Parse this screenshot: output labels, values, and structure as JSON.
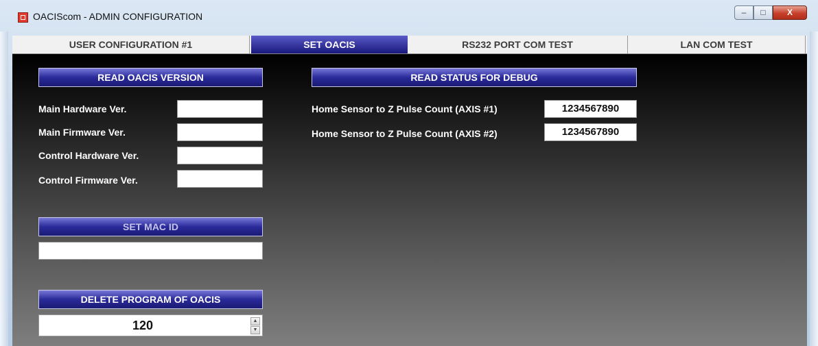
{
  "window": {
    "title": "OACIScom - ADMIN CONFIGURATION",
    "controls": {
      "minimize": "–",
      "maximize": "□",
      "close": "X"
    }
  },
  "tabs": [
    {
      "label": "USER CONFIGURATION #1"
    },
    {
      "label": "SET OACIS",
      "active": true
    },
    {
      "label": "RS232 PORT COM TEST"
    },
    {
      "label": "LAN COM TEST"
    }
  ],
  "version": {
    "button": "READ OACIS VERSION",
    "fields": [
      {
        "label": "Main Hardware Ver.",
        "value": ""
      },
      {
        "label": "Main Firmware Ver.",
        "value": ""
      },
      {
        "label": "Control Hardware Ver.",
        "value": ""
      },
      {
        "label": "Control Firmware Ver.",
        "value": ""
      }
    ]
  },
  "debug": {
    "button": "READ STATUS FOR DEBUG",
    "rows": [
      {
        "label": "Home Sensor to Z Pulse Count (AXIS #1)",
        "value": "1234567890"
      },
      {
        "label": "Home Sensor to Z Pulse Count (AXIS #2)",
        "value": "1234567890"
      }
    ]
  },
  "mac": {
    "button": "SET MAC ID",
    "value": ""
  },
  "delete": {
    "button": "DELETE PROGRAM OF OACIS",
    "value": "120",
    "up": "▲",
    "down": "▼"
  },
  "colors": {
    "tab_active": "#1f1f85",
    "button": "#2a2a9a",
    "content_top": "#000000",
    "content_bottom": "#7e7e7e"
  }
}
